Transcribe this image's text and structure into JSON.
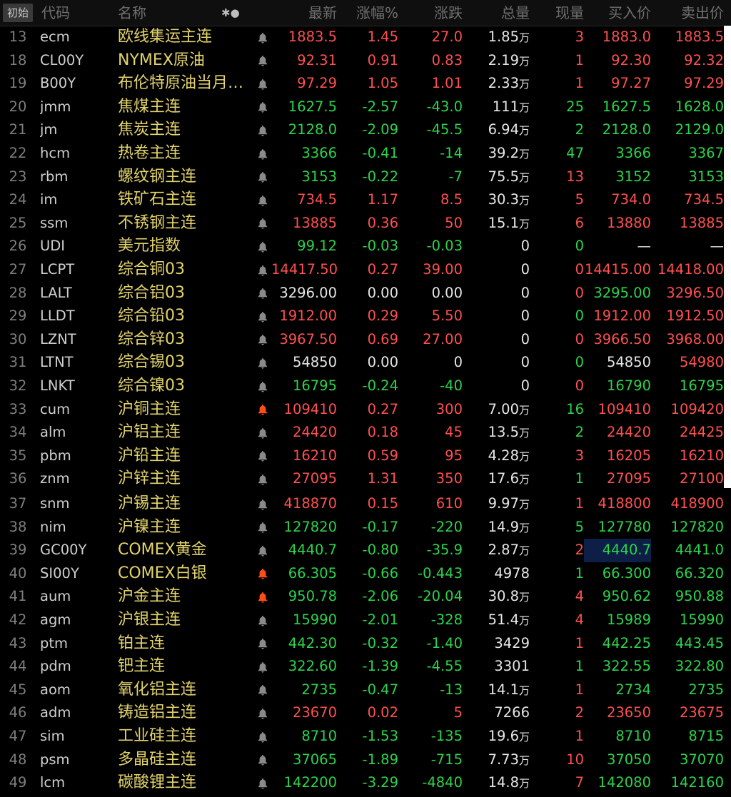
{
  "header": {
    "tab": "初始",
    "code": "代码",
    "name": "名称",
    "icons": "✱●",
    "price": "最新",
    "pct": "涨幅%",
    "chg": "涨跌",
    "vol": "总量",
    "cur": "现量",
    "bid": "买入价",
    "ask": "卖出价"
  },
  "colors": {
    "up": "#ff5050",
    "down": "#2bd44a",
    "flat": "#e6e6e6",
    "name": "#e3d36b",
    "bell_active": "#ff4d1a",
    "bell": "#8a8a8a"
  },
  "rows": [
    {
      "n": "13",
      "code": "ecm",
      "name": "欧线集运主连",
      "alert": false,
      "price": "1883.5",
      "pct": "1.45",
      "chg": "27.0",
      "vol": "1.85",
      "unit": "万",
      "cur": "3",
      "bid": "1883.0",
      "ask": "1883.5",
      "pc": "up",
      "cc": "up",
      "bc": "up",
      "ac": "up"
    },
    {
      "n": "18",
      "code": "CL00Y",
      "name": "NYMEX原油",
      "alert": false,
      "price": "92.31",
      "pct": "0.91",
      "chg": "0.83",
      "vol": "2.19",
      "unit": "万",
      "cur": "1",
      "bid": "92.30",
      "ask": "92.32",
      "pc": "up",
      "cc": "up",
      "bc": "up",
      "ac": "up"
    },
    {
      "n": "19",
      "code": "B00Y",
      "name": "布伦特原油当月…",
      "alert": false,
      "price": "97.29",
      "pct": "1.05",
      "chg": "1.01",
      "vol": "2.33",
      "unit": "万",
      "cur": "1",
      "bid": "97.27",
      "ask": "97.29",
      "pc": "up",
      "cc": "up",
      "bc": "up",
      "ac": "up"
    },
    {
      "n": "20",
      "code": "jmm",
      "name": "焦煤主连",
      "alert": false,
      "price": "1627.5",
      "pct": "-2.57",
      "chg": "-43.0",
      "vol": "111",
      "unit": "万",
      "cur": "25",
      "bid": "1627.5",
      "ask": "1628.0",
      "pc": "down",
      "cc": "down",
      "bc": "down",
      "ac": "down"
    },
    {
      "n": "21",
      "code": "jm",
      "name": "焦炭主连",
      "alert": false,
      "price": "2128.0",
      "pct": "-2.09",
      "chg": "-45.5",
      "vol": "6.94",
      "unit": "万",
      "cur": "2",
      "bid": "2128.0",
      "ask": "2129.0",
      "pc": "down",
      "cc": "down",
      "bc": "down",
      "ac": "down"
    },
    {
      "n": "22",
      "code": "hcm",
      "name": "热卷主连",
      "alert": false,
      "price": "3366",
      "pct": "-0.41",
      "chg": "-14",
      "vol": "39.2",
      "unit": "万",
      "cur": "47",
      "bid": "3366",
      "ask": "3367",
      "pc": "down",
      "cc": "down",
      "bc": "down",
      "ac": "down"
    },
    {
      "n": "23",
      "code": "rbm",
      "name": "螺纹钢主连",
      "alert": false,
      "price": "3153",
      "pct": "-0.22",
      "chg": "-7",
      "vol": "75.5",
      "unit": "万",
      "cur": "13",
      "bid": "3152",
      "ask": "3153",
      "pc": "down",
      "cc": "up",
      "bc": "down",
      "ac": "down"
    },
    {
      "n": "24",
      "code": "im",
      "name": "铁矿石主连",
      "alert": false,
      "price": "734.5",
      "pct": "1.17",
      "chg": "8.5",
      "vol": "30.3",
      "unit": "万",
      "cur": "5",
      "bid": "734.0",
      "ask": "734.5",
      "pc": "up",
      "cc": "up",
      "bc": "up",
      "ac": "up"
    },
    {
      "n": "25",
      "code": "ssm",
      "name": "不锈钢主连",
      "alert": false,
      "price": "13885",
      "pct": "0.36",
      "chg": "50",
      "vol": "15.1",
      "unit": "万",
      "cur": "6",
      "bid": "13880",
      "ask": "13885",
      "pc": "up",
      "cc": "up",
      "bc": "up",
      "ac": "up"
    },
    {
      "n": "26",
      "code": "UDI",
      "name": "美元指数",
      "alert": false,
      "price": "99.12",
      "pct": "-0.03",
      "chg": "-0.03",
      "vol": "0",
      "unit": "",
      "cur": "0",
      "bid": "—",
      "ask": "—",
      "pc": "down",
      "cc": "down",
      "bc": "flat",
      "ac": "flat"
    },
    {
      "n": "27",
      "code": "LCPT",
      "name": "综合铜03",
      "alert": false,
      "price": "14417.50",
      "pct": "0.27",
      "chg": "39.00",
      "vol": "0",
      "unit": "",
      "cur": "0",
      "bid": "14415.00",
      "ask": "14418.00",
      "pc": "up",
      "cc": "up",
      "bc": "up",
      "ac": "up"
    },
    {
      "n": "28",
      "code": "LALT",
      "name": "综合铝03",
      "alert": false,
      "price": "3296.00",
      "pct": "0.00",
      "chg": "0.00",
      "vol": "0",
      "unit": "",
      "cur": "0",
      "bid": "3295.00",
      "ask": "3296.50",
      "pc": "flat",
      "cc": "up",
      "bc": "down",
      "ac": "up"
    },
    {
      "n": "29",
      "code": "LLDT",
      "name": "综合铅03",
      "alert": false,
      "price": "1912.00",
      "pct": "0.29",
      "chg": "5.50",
      "vol": "0",
      "unit": "",
      "cur": "0",
      "bid": "1912.00",
      "ask": "1912.50",
      "pc": "up",
      "cc": "down",
      "bc": "up",
      "ac": "up"
    },
    {
      "n": "30",
      "code": "LZNT",
      "name": "综合锌03",
      "alert": false,
      "price": "3967.50",
      "pct": "0.69",
      "chg": "27.00",
      "vol": "0",
      "unit": "",
      "cur": "0",
      "bid": "3966.50",
      "ask": "3968.00",
      "pc": "up",
      "cc": "up",
      "bc": "up",
      "ac": "up"
    },
    {
      "n": "31",
      "code": "LTNT",
      "name": "综合锡03",
      "alert": false,
      "price": "54850",
      "pct": "0.00",
      "chg": "0",
      "vol": "0",
      "unit": "",
      "cur": "0",
      "bid": "54850",
      "ask": "54980",
      "pc": "flat",
      "cc": "down",
      "bc": "flat",
      "ac": "up"
    },
    {
      "n": "32",
      "code": "LNKT",
      "name": "综合镍03",
      "alert": false,
      "price": "16795",
      "pct": "-0.24",
      "chg": "-40",
      "vol": "0",
      "unit": "",
      "cur": "0",
      "bid": "16790",
      "ask": "16795",
      "pc": "down",
      "cc": "up",
      "bc": "down",
      "ac": "down"
    },
    {
      "n": "33",
      "code": "cum",
      "name": "沪铜主连",
      "alert": true,
      "price": "109410",
      "pct": "0.27",
      "chg": "300",
      "vol": "7.00",
      "unit": "万",
      "cur": "16",
      "bid": "109410",
      "ask": "109420",
      "pc": "up",
      "cc": "down",
      "bc": "up",
      "ac": "up"
    },
    {
      "n": "34",
      "code": "alm",
      "name": "沪铝主连",
      "alert": false,
      "price": "24420",
      "pct": "0.18",
      "chg": "45",
      "vol": "13.5",
      "unit": "万",
      "cur": "2",
      "bid": "24420",
      "ask": "24425",
      "pc": "up",
      "cc": "down",
      "bc": "up",
      "ac": "up"
    },
    {
      "n": "35",
      "code": "pbm",
      "name": "沪铅主连",
      "alert": false,
      "price": "16210",
      "pct": "0.59",
      "chg": "95",
      "vol": "4.28",
      "unit": "万",
      "cur": "3",
      "bid": "16205",
      "ask": "16210",
      "pc": "up",
      "cc": "up",
      "bc": "up",
      "ac": "up"
    },
    {
      "n": "36",
      "code": "znm",
      "name": "沪锌主连",
      "alert": false,
      "price": "27095",
      "pct": "1.31",
      "chg": "350",
      "vol": "17.6",
      "unit": "万",
      "cur": "1",
      "bid": "27095",
      "ask": "27100",
      "pc": "up",
      "cc": "down",
      "bc": "up",
      "ac": "up"
    },
    {
      "n": "37",
      "code": "snm",
      "name": "沪锡主连",
      "alert": false,
      "price": "418870",
      "pct": "0.15",
      "chg": "610",
      "vol": "9.97",
      "unit": "万",
      "cur": "1",
      "bid": "418800",
      "ask": "418900",
      "pc": "up",
      "cc": "up",
      "bc": "up",
      "ac": "up"
    },
    {
      "n": "38",
      "code": "nim",
      "name": "沪镍主连",
      "alert": false,
      "price": "127820",
      "pct": "-0.17",
      "chg": "-220",
      "vol": "14.9",
      "unit": "万",
      "cur": "5",
      "bid": "127780",
      "ask": "127820",
      "pc": "down",
      "cc": "down",
      "bc": "down",
      "ac": "down"
    },
    {
      "n": "39",
      "code": "GC00Y",
      "name": "COMEX黄金",
      "alert": false,
      "price": "4440.7",
      "pct": "-0.80",
      "chg": "-35.9",
      "vol": "2.87",
      "unit": "万",
      "cur": "2",
      "bid": "4440.7",
      "ask": "4441.0",
      "pc": "down",
      "cc": "up",
      "bc": "down",
      "ac": "down",
      "hl": true
    },
    {
      "n": "40",
      "code": "SI00Y",
      "name": "COMEX白银",
      "alert": true,
      "price": "66.305",
      "pct": "-0.66",
      "chg": "-0.443",
      "vol": "4978",
      "unit": "",
      "cur": "1",
      "bid": "66.300",
      "ask": "66.320",
      "pc": "down",
      "cc": "down",
      "bc": "down",
      "ac": "down"
    },
    {
      "n": "41",
      "code": "aum",
      "name": "沪金主连",
      "alert": true,
      "price": "950.78",
      "pct": "-2.06",
      "chg": "-20.04",
      "vol": "30.8",
      "unit": "万",
      "cur": "4",
      "bid": "950.62",
      "ask": "950.88",
      "pc": "down",
      "cc": "up",
      "bc": "down",
      "ac": "down"
    },
    {
      "n": "42",
      "code": "agm",
      "name": "沪银主连",
      "alert": false,
      "price": "15990",
      "pct": "-2.01",
      "chg": "-328",
      "vol": "51.4",
      "unit": "万",
      "cur": "4",
      "bid": "15989",
      "ask": "15990",
      "pc": "down",
      "cc": "up",
      "bc": "down",
      "ac": "down"
    },
    {
      "n": "43",
      "code": "ptm",
      "name": "铂主连",
      "alert": false,
      "price": "442.30",
      "pct": "-0.32",
      "chg": "-1.40",
      "vol": "3429",
      "unit": "",
      "cur": "1",
      "bid": "442.25",
      "ask": "443.45",
      "pc": "down",
      "cc": "up",
      "bc": "down",
      "ac": "down"
    },
    {
      "n": "44",
      "code": "pdm",
      "name": "钯主连",
      "alert": false,
      "price": "322.60",
      "pct": "-1.39",
      "chg": "-4.55",
      "vol": "3301",
      "unit": "",
      "cur": "1",
      "bid": "322.55",
      "ask": "322.80",
      "pc": "down",
      "cc": "down",
      "bc": "down",
      "ac": "down"
    },
    {
      "n": "45",
      "code": "aom",
      "name": "氧化铝主连",
      "alert": false,
      "price": "2735",
      "pct": "-0.47",
      "chg": "-13",
      "vol": "14.1",
      "unit": "万",
      "cur": "1",
      "bid": "2734",
      "ask": "2735",
      "pc": "down",
      "cc": "up",
      "bc": "down",
      "ac": "down"
    },
    {
      "n": "46",
      "code": "adm",
      "name": "铸造铝主连",
      "alert": false,
      "price": "23670",
      "pct": "0.02",
      "chg": "5",
      "vol": "7266",
      "unit": "",
      "cur": "2",
      "bid": "23650",
      "ask": "23675",
      "pc": "up",
      "cc": "up",
      "bc": "up",
      "ac": "up"
    },
    {
      "n": "47",
      "code": "sim",
      "name": "工业硅主连",
      "alert": false,
      "price": "8710",
      "pct": "-1.53",
      "chg": "-135",
      "vol": "19.6",
      "unit": "万",
      "cur": "1",
      "bid": "8710",
      "ask": "8715",
      "pc": "down",
      "cc": "up",
      "bc": "down",
      "ac": "down"
    },
    {
      "n": "48",
      "code": "psm",
      "name": "多晶硅主连",
      "alert": false,
      "price": "37065",
      "pct": "-1.89",
      "chg": "-715",
      "vol": "7.73",
      "unit": "万",
      "cur": "10",
      "bid": "37050",
      "ask": "37070",
      "pc": "down",
      "cc": "up",
      "bc": "down",
      "ac": "down"
    },
    {
      "n": "49",
      "code": "lcm",
      "name": "碳酸锂主连",
      "alert": false,
      "price": "142200",
      "pct": "-3.29",
      "chg": "-4840",
      "vol": "14.8",
      "unit": "万",
      "cur": "7",
      "bid": "142080",
      "ask": "142160",
      "pc": "down",
      "cc": "up",
      "bc": "down",
      "ac": "down"
    }
  ]
}
